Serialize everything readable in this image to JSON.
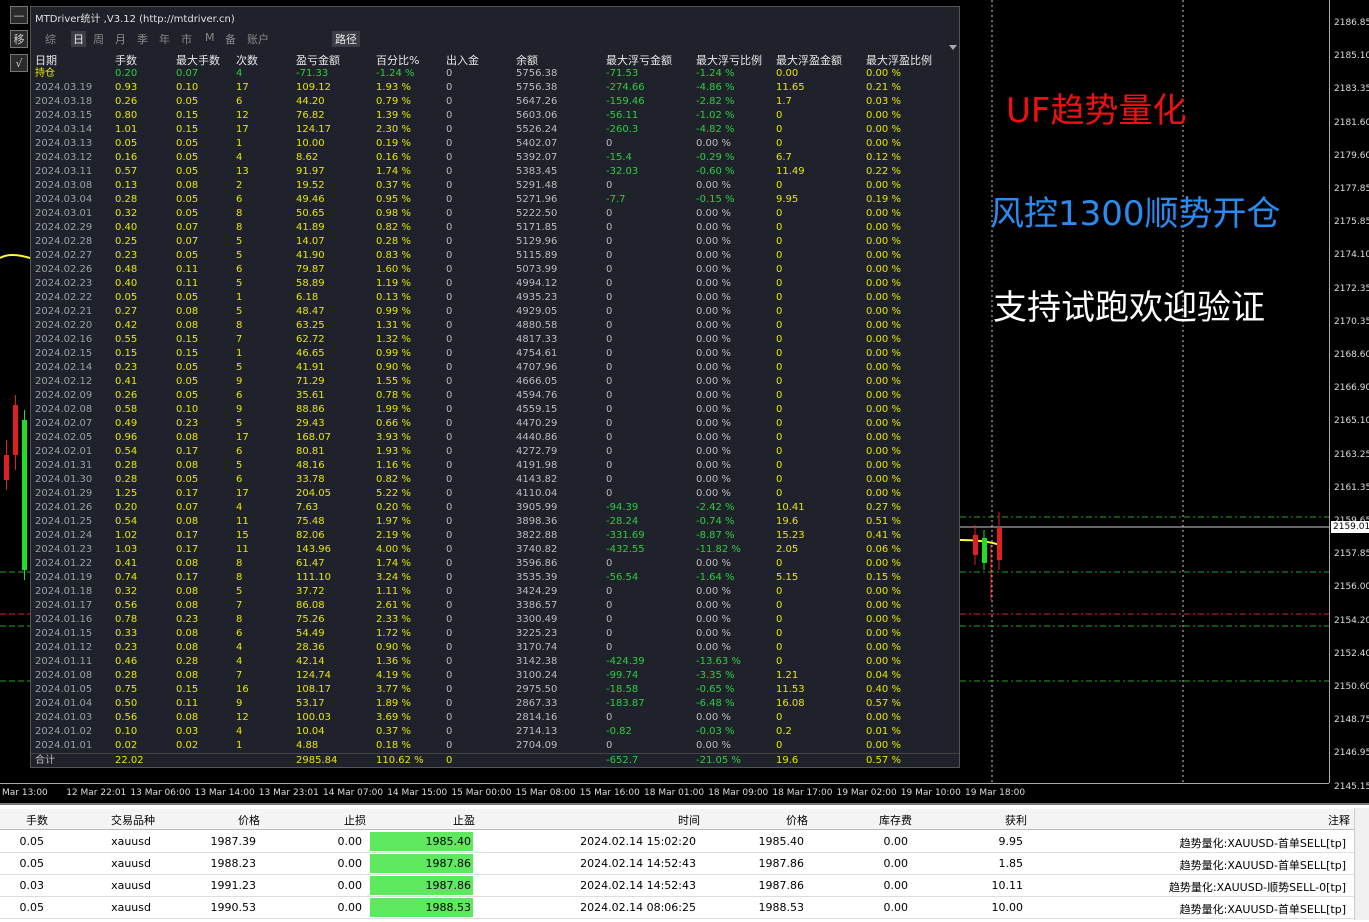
{
  "panel": {
    "title": "MTDriver统计 ,V3.12 (http://mtdriver.cn)",
    "tabs": [
      "综",
      "日",
      "周",
      "月",
      "季",
      "年",
      "市",
      "M",
      "备",
      "账户"
    ],
    "active_tab": "日",
    "path_button": "路径",
    "columns": [
      "日期",
      "手数",
      "最大手数",
      "次数",
      "盈亏金额",
      "百分比%",
      "出入金",
      "余额",
      "最大浮亏金额",
      "最大浮亏比例",
      "最大浮盈金额",
      "最大浮盈比例"
    ],
    "rows": [
      [
        "持仓",
        "0.20",
        "0.07",
        "4",
        "-71.33",
        "-1.24 %",
        "0",
        "5756.38",
        "-71.53",
        "-1.24 %",
        "0.00",
        "0.00 %"
      ],
      [
        "2024.03.19",
        "0.93",
        "0.10",
        "17",
        "109.12",
        "1.93 %",
        "0",
        "5756.38",
        "-274.66",
        "-4.86 %",
        "11.65",
        "0.21 %"
      ],
      [
        "2024.03.18",
        "0.26",
        "0.05",
        "6",
        "44.20",
        "0.79 %",
        "0",
        "5647.26",
        "-159.46",
        "-2.82 %",
        "1.7",
        "0.03 %"
      ],
      [
        "2024.03.15",
        "0.80",
        "0.15",
        "12",
        "76.82",
        "1.39 %",
        "0",
        "5603.06",
        "-56.11",
        "-1.02 %",
        "0",
        "0.00 %"
      ],
      [
        "2024.03.14",
        "1.01",
        "0.15",
        "17",
        "124.17",
        "2.30 %",
        "0",
        "5526.24",
        "-260.3",
        "-4.82 %",
        "0",
        "0.00 %"
      ],
      [
        "2024.03.13",
        "0.05",
        "0.05",
        "1",
        "10.00",
        "0.19 %",
        "0",
        "5402.07",
        "0",
        "0.00 %",
        "0",
        "0.00 %"
      ],
      [
        "2024.03.12",
        "0.16",
        "0.05",
        "4",
        "8.62",
        "0.16 %",
        "0",
        "5392.07",
        "-15.4",
        "-0.29 %",
        "6.7",
        "0.12 %"
      ],
      [
        "2024.03.11",
        "0.57",
        "0.05",
        "13",
        "91.97",
        "1.74 %",
        "0",
        "5383.45",
        "-32.03",
        "-0.60 %",
        "11.49",
        "0.22 %"
      ],
      [
        "2024.03.08",
        "0.13",
        "0.08",
        "2",
        "19.52",
        "0.37 %",
        "0",
        "5291.48",
        "0",
        "0.00 %",
        "0",
        "0.00 %"
      ],
      [
        "2024.03.04",
        "0.28",
        "0.05",
        "6",
        "49.46",
        "0.95 %",
        "0",
        "5271.96",
        "-7.7",
        "-0.15 %",
        "9.95",
        "0.19 %"
      ],
      [
        "2024.03.01",
        "0.32",
        "0.05",
        "8",
        "50.65",
        "0.98 %",
        "0",
        "5222.50",
        "0",
        "0.00 %",
        "0",
        "0.00 %"
      ],
      [
        "2024.02.29",
        "0.40",
        "0.07",
        "8",
        "41.89",
        "0.82 %",
        "0",
        "5171.85",
        "0",
        "0.00 %",
        "0",
        "0.00 %"
      ],
      [
        "2024.02.28",
        "0.25",
        "0.07",
        "5",
        "14.07",
        "0.28 %",
        "0",
        "5129.96",
        "0",
        "0.00 %",
        "0",
        "0.00 %"
      ],
      [
        "2024.02.27",
        "0.23",
        "0.05",
        "5",
        "41.90",
        "0.83 %",
        "0",
        "5115.89",
        "0",
        "0.00 %",
        "0",
        "0.00 %"
      ],
      [
        "2024.02.26",
        "0.48",
        "0.11",
        "6",
        "79.87",
        "1.60 %",
        "0",
        "5073.99",
        "0",
        "0.00 %",
        "0",
        "0.00 %"
      ],
      [
        "2024.02.23",
        "0.40",
        "0.11",
        "5",
        "58.89",
        "1.19 %",
        "0",
        "4994.12",
        "0",
        "0.00 %",
        "0",
        "0.00 %"
      ],
      [
        "2024.02.22",
        "0.05",
        "0.05",
        "1",
        "6.18",
        "0.13 %",
        "0",
        "4935.23",
        "0",
        "0.00 %",
        "0",
        "0.00 %"
      ],
      [
        "2024.02.21",
        "0.27",
        "0.08",
        "5",
        "48.47",
        "0.99 %",
        "0",
        "4929.05",
        "0",
        "0.00 %",
        "0",
        "0.00 %"
      ],
      [
        "2024.02.20",
        "0.42",
        "0.08",
        "8",
        "63.25",
        "1.31 %",
        "0",
        "4880.58",
        "0",
        "0.00 %",
        "0",
        "0.00 %"
      ],
      [
        "2024.02.16",
        "0.55",
        "0.15",
        "7",
        "62.72",
        "1.32 %",
        "0",
        "4817.33",
        "0",
        "0.00 %",
        "0",
        "0.00 %"
      ],
      [
        "2024.02.15",
        "0.15",
        "0.15",
        "1",
        "46.65",
        "0.99 %",
        "0",
        "4754.61",
        "0",
        "0.00 %",
        "0",
        "0.00 %"
      ],
      [
        "2024.02.14",
        "0.23",
        "0.05",
        "5",
        "41.91",
        "0.90 %",
        "0",
        "4707.96",
        "0",
        "0.00 %",
        "0",
        "0.00 %"
      ],
      [
        "2024.02.12",
        "0.41",
        "0.05",
        "9",
        "71.29",
        "1.55 %",
        "0",
        "4666.05",
        "0",
        "0.00 %",
        "0",
        "0.00 %"
      ],
      [
        "2024.02.09",
        "0.26",
        "0.05",
        "6",
        "35.61",
        "0.78 %",
        "0",
        "4594.76",
        "0",
        "0.00 %",
        "0",
        "0.00 %"
      ],
      [
        "2024.02.08",
        "0.58",
        "0.10",
        "9",
        "88.86",
        "1.99 %",
        "0",
        "4559.15",
        "0",
        "0.00 %",
        "0",
        "0.00 %"
      ],
      [
        "2024.02.07",
        "0.49",
        "0.23",
        "5",
        "29.43",
        "0.66 %",
        "0",
        "4470.29",
        "0",
        "0.00 %",
        "0",
        "0.00 %"
      ],
      [
        "2024.02.05",
        "0.96",
        "0.08",
        "17",
        "168.07",
        "3.93 %",
        "0",
        "4440.86",
        "0",
        "0.00 %",
        "0",
        "0.00 %"
      ],
      [
        "2024.02.01",
        "0.54",
        "0.17",
        "6",
        "80.81",
        "1.93 %",
        "0",
        "4272.79",
        "0",
        "0.00 %",
        "0",
        "0.00 %"
      ],
      [
        "2024.01.31",
        "0.28",
        "0.08",
        "5",
        "48.16",
        "1.16 %",
        "0",
        "4191.98",
        "0",
        "0.00 %",
        "0",
        "0.00 %"
      ],
      [
        "2024.01.30",
        "0.28",
        "0.05",
        "6",
        "33.78",
        "0.82 %",
        "0",
        "4143.82",
        "0",
        "0.00 %",
        "0",
        "0.00 %"
      ],
      [
        "2024.01.29",
        "1.25",
        "0.17",
        "17",
        "204.05",
        "5.22 %",
        "0",
        "4110.04",
        "0",
        "0.00 %",
        "0",
        "0.00 %"
      ],
      [
        "2024.01.26",
        "0.20",
        "0.07",
        "4",
        "7.63",
        "0.20 %",
        "0",
        "3905.99",
        "-94.39",
        "-2.42 %",
        "10.41",
        "0.27 %"
      ],
      [
        "2024.01.25",
        "0.54",
        "0.08",
        "11",
        "75.48",
        "1.97 %",
        "0",
        "3898.36",
        "-28.24",
        "-0.74 %",
        "19.6",
        "0.51 %"
      ],
      [
        "2024.01.24",
        "1.02",
        "0.17",
        "15",
        "82.06",
        "2.19 %",
        "0",
        "3822.88",
        "-331.69",
        "-8.87 %",
        "15.23",
        "0.41 %"
      ],
      [
        "2024.01.23",
        "1.03",
        "0.17",
        "11",
        "143.96",
        "4.00 %",
        "0",
        "3740.82",
        "-432.55",
        "-11.82 %",
        "2.05",
        "0.06 %"
      ],
      [
        "2024.01.22",
        "0.41",
        "0.08",
        "8",
        "61.47",
        "1.74 %",
        "0",
        "3596.86",
        "0",
        "0.00 %",
        "0",
        "0.00 %"
      ],
      [
        "2024.01.19",
        "0.74",
        "0.17",
        "8",
        "111.10",
        "3.24 %",
        "0",
        "3535.39",
        "-56.54",
        "-1.64 %",
        "5.15",
        "0.15 %"
      ],
      [
        "2024.01.18",
        "0.32",
        "0.08",
        "5",
        "37.72",
        "1.11 %",
        "0",
        "3424.29",
        "0",
        "0.00 %",
        "0",
        "0.00 %"
      ],
      [
        "2024.01.17",
        "0.56",
        "0.08",
        "7",
        "86.08",
        "2.61 %",
        "0",
        "3386.57",
        "0",
        "0.00 %",
        "0",
        "0.00 %"
      ],
      [
        "2024.01.16",
        "0.78",
        "0.23",
        "8",
        "75.26",
        "2.33 %",
        "0",
        "3300.49",
        "0",
        "0.00 %",
        "0",
        "0.00 %"
      ],
      [
        "2024.01.15",
        "0.33",
        "0.08",
        "6",
        "54.49",
        "1.72 %",
        "0",
        "3225.23",
        "0",
        "0.00 %",
        "0",
        "0.00 %"
      ],
      [
        "2024.01.12",
        "0.23",
        "0.08",
        "4",
        "28.36",
        "0.90 %",
        "0",
        "3170.74",
        "0",
        "0.00 %",
        "0",
        "0.00 %"
      ],
      [
        "2024.01.11",
        "0.46",
        "0.28",
        "4",
        "42.14",
        "1.36 %",
        "0",
        "3142.38",
        "-424.39",
        "-13.63 %",
        "0",
        "0.00 %"
      ],
      [
        "2024.01.08",
        "0.28",
        "0.08",
        "7",
        "124.74",
        "4.19 %",
        "0",
        "3100.24",
        "-99.74",
        "-3.35 %",
        "1.21",
        "0.04 %"
      ],
      [
        "2024.01.05",
        "0.75",
        "0.15",
        "16",
        "108.17",
        "3.77 %",
        "0",
        "2975.50",
        "-18.58",
        "-0.65 %",
        "11.53",
        "0.40 %"
      ],
      [
        "2024.01.04",
        "0.50",
        "0.11",
        "9",
        "53.17",
        "1.89 %",
        "0",
        "2867.33",
        "-183.87",
        "-6.48 %",
        "16.08",
        "0.57 %"
      ],
      [
        "2024.01.03",
        "0.56",
        "0.08",
        "12",
        "100.03",
        "3.69 %",
        "0",
        "2814.16",
        "0",
        "0.00 %",
        "0",
        "0.00 %"
      ],
      [
        "2024.01.02",
        "0.10",
        "0.03",
        "4",
        "10.04",
        "0.37 %",
        "0",
        "2714.13",
        "-0.82",
        "-0.03 %",
        "0.2",
        "0.01 %"
      ],
      [
        "2024.01.01",
        "0.02",
        "0.02",
        "1",
        "4.88",
        "0.18 %",
        "0",
        "2704.09",
        "0",
        "0.00 %",
        "0",
        "0.00 %"
      ]
    ],
    "total": [
      "合计",
      "22.02",
      "",
      "",
      "2985.84",
      "110.62 %",
      "0",
      "",
      "-652.7",
      "-21.05 %",
      "19.6",
      "0.57 %"
    ]
  },
  "overlay": {
    "line1": "UF趋势量化",
    "line2": "风控1300顺势开仓",
    "line3": "支持试跑欢迎验证"
  },
  "left_buttons": [
    "—",
    "移",
    "√"
  ],
  "price_axis": [
    "2186.85",
    "2185.10",
    "2183.35",
    "2181.60",
    "2179.60",
    "2177.85",
    "2175.85",
    "2174.10",
    "2172.35",
    "2170.35",
    "2168.60",
    "2166.90",
    "2165.10",
    "2163.25",
    "2161.35",
    "2159.65",
    "2157.85",
    "2156.00",
    "2154.20",
    "2152.40",
    "2150.60",
    "2148.75",
    "2146.95",
    "2145.15"
  ],
  "current_price": "2159.01",
  "time_axis": [
    "Mar 13:00",
    "12 Mar 22:01",
    "13 Mar 06:00",
    "13 Mar 14:00",
    "13 Mar 23:01",
    "14 Mar 07:00",
    "14 Mar 15:00",
    "15 Mar 00:00",
    "15 Mar 08:00",
    "15 Mar 16:00",
    "18 Mar 01:00",
    "18 Mar 09:00",
    "18 Mar 17:00",
    "19 Mar 02:00",
    "19 Mar 10:00",
    "19 Mar 18:00"
  ],
  "terminal": {
    "headers": [
      "手数",
      "交易品种",
      "价格",
      "止损",
      "止盈",
      "时间",
      "价格",
      "库存费",
      "获利",
      "注释"
    ],
    "rows": [
      [
        "0.05",
        "xauusd",
        "1987.39",
        "0.00",
        "1985.40",
        "2024.02.14 15:02:20",
        "1985.40",
        "0.00",
        "9.95",
        "趋势量化:XAUUSD-首单SELL[tp]"
      ],
      [
        "0.05",
        "xauusd",
        "1988.23",
        "0.00",
        "1987.86",
        "2024.02.14 14:52:43",
        "1987.86",
        "0.00",
        "1.85",
        "趋势量化:XAUUSD-首单SELL[tp]"
      ],
      [
        "0.03",
        "xauusd",
        "1991.23",
        "0.00",
        "1987.86",
        "2024.02.14 14:52:43",
        "1987.86",
        "0.00",
        "10.11",
        "趋势量化:XAUUSD-顺势SELL-0[tp]"
      ],
      [
        "0.05",
        "xauusd",
        "1990.53",
        "0.00",
        "1988.53",
        "2024.02.14 08:06:25",
        "1988.53",
        "0.00",
        "10.00",
        "趋势量化:XAUUSD-首单SELL[tp]"
      ]
    ]
  },
  "colors": {
    "tp_highlight": "#5ee85e",
    "loss_green": "#2ecc40",
    "yellow_text": "#e6e600"
  }
}
